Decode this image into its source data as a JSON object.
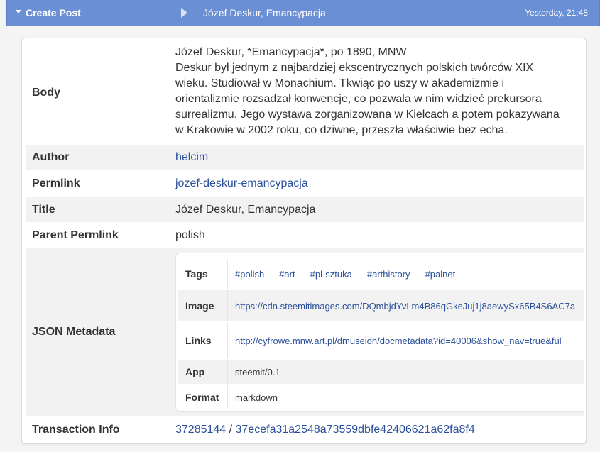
{
  "header": {
    "operation": "Create Post",
    "post_title": "Józef Deskur, Emancypacja",
    "timestamp": "Yesterday, 21:48"
  },
  "fields": {
    "body": {
      "label": "Body",
      "lines": [
        "Józef Deskur, *Emancypacja*, po 1890, MNW",
        "Deskur był jednym z najbardziej ekscentrycznych polskich twórców XIX",
        "wieku. Studiował w Monachium. Tkwiąc po uszy w akademizmie i",
        "orientalizmie rozsadzał konwencje, co pozwala w nim widzieć prekursora",
        "surrealizmu. Jego wystawa zorganizowana w Kielcach a potem pokazywana",
        "w Krakowie w 2002 roku, co dziwne, przeszła właściwie bez echa."
      ]
    },
    "author": {
      "label": "Author",
      "value": "helcim"
    },
    "permlink": {
      "label": "Permlink",
      "value": "jozef-deskur-emancypacja"
    },
    "title": {
      "label": "Title",
      "value": "Józef Deskur, Emancypacja"
    },
    "parent_permlink": {
      "label": "Parent Permlink",
      "value": "polish"
    },
    "json_metadata": {
      "label": "JSON Metadata",
      "tags_label": "Tags",
      "tags": [
        "#polish",
        "#art",
        "#pl-sztuka",
        "#arthistory",
        "#palnet"
      ],
      "image_label": "Image",
      "image": "https://cdn.steemitimages.com/DQmbjdYvLm4B86qGkeJuj1j8aewySx65B4S6AC7a",
      "links_label": "Links",
      "links": "http://cyfrowe.mnw.art.pl/dmuseion/docmetadata?id=40006&show_nav=true&ful",
      "app_label": "App",
      "app": "steemit/0.1",
      "format_label": "Format",
      "format": "markdown"
    },
    "transaction": {
      "label": "Transaction Info",
      "block": "37285144",
      "separator": " / ",
      "txid": "37ecefa31a2548a73559dbfe42406621a62fa8f4"
    }
  },
  "colors": {
    "header_bg": "#6a8fd4",
    "link": "#2a4f9b",
    "row_shade": "#f2f2f2"
  }
}
